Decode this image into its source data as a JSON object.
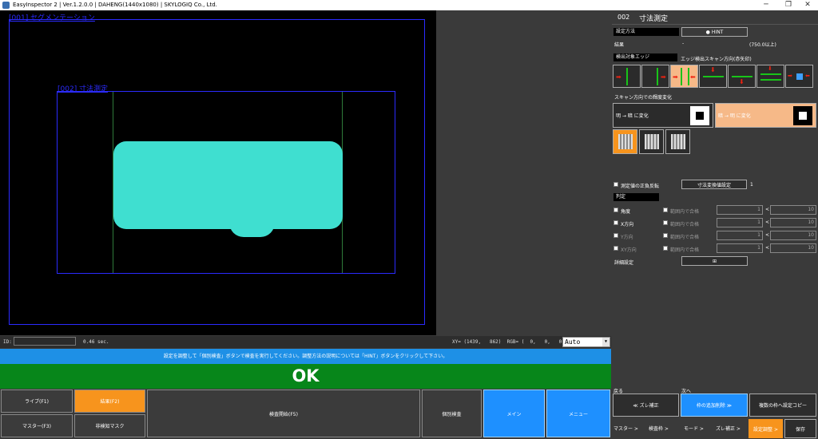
{
  "window": {
    "title": "EasyInspector 2 | Ver.1.2.0.0 | DAHENG(1440x1080) | SKYLOGIQ Co., Ltd.",
    "minimize": "─",
    "maximize": "❐",
    "close": "✕"
  },
  "image_view": {
    "roi1_label": "[001] セグメンテーション",
    "roi2_label": "[002] 寸法測定"
  },
  "status": {
    "id_label": "ID:",
    "id_value": "",
    "time": "0.46 sec.",
    "xy": "XY= (1439,   862)  RGB= (  0,   0,   0)",
    "zoom": "Auto"
  },
  "message": "設定を調整して「個別検査」ボタンで検査を実行してください。調整方法の説明については「HINT」ボタンをクリックして下さい。",
  "result": "OK",
  "bottom_buttons": {
    "live": "ライブ(F1)",
    "result": "結果(F2)",
    "master": "マスター(F3)",
    "mask": "非検知マスク",
    "inspect": "検査開始(F5)",
    "individual": "個別検査",
    "main": "メイン",
    "menu": "メニュー"
  },
  "panel": {
    "tool_no": "002",
    "tool_name": "寸法測定",
    "setting_method_label": "設定方法",
    "hint_button": "HINT",
    "hint_icon": "lightbulb-icon",
    "result_label": "結果",
    "result_value": "-",
    "result_range": "(750.0以上)",
    "edge_target_label": "検出対象エッジ",
    "scan_direction_label": "エッジ検出スキャン方向(赤矢印)",
    "brightness_change_label": "スキャン方向での輝度変化",
    "dark_to_light": "明 → 暗 に変化",
    "light_to_dark": "暗 → 明 に変化",
    "invert_label": "測定値の正負反転",
    "scale_button": "寸法変換値設定",
    "scale_value": "1",
    "judge_label": "判定",
    "judge_rows": [
      {
        "name": "角度",
        "range_label": "範囲内で合格",
        "min": "1",
        "max": "10"
      },
      {
        "name": "X方向",
        "range_label": "範囲内で合格",
        "min": "1",
        "max": "10"
      },
      {
        "name": "Y方向",
        "range_label": "範囲内で合格",
        "min": "1",
        "max": "10"
      },
      {
        "name": "XY方向",
        "range_label": "範囲内で合格",
        "min": "1",
        "max": "10"
      }
    ],
    "lt_symbol": "<",
    "detail_label": "詳細設定",
    "detail_button": "⊞",
    "back_label": "戻る",
    "next_label": "次へ",
    "back_button": "≪ ズレ補正",
    "next_button": "枠の追加削除 ≫",
    "copy_button": "複数の枠へ設定コピー",
    "nav_items": [
      "マスター >",
      "検査枠 >",
      "モード >",
      "ズレ補正 >"
    ],
    "nav_active": "設定調整 >",
    "save_button": "保存"
  },
  "colors": {
    "accent_orange": "#f7941d",
    "ok_green": "#07861a",
    "info_blue": "#1e90e6",
    "blob_cyan": "#3fdfd0",
    "roi_blue": "#2b2bff"
  }
}
